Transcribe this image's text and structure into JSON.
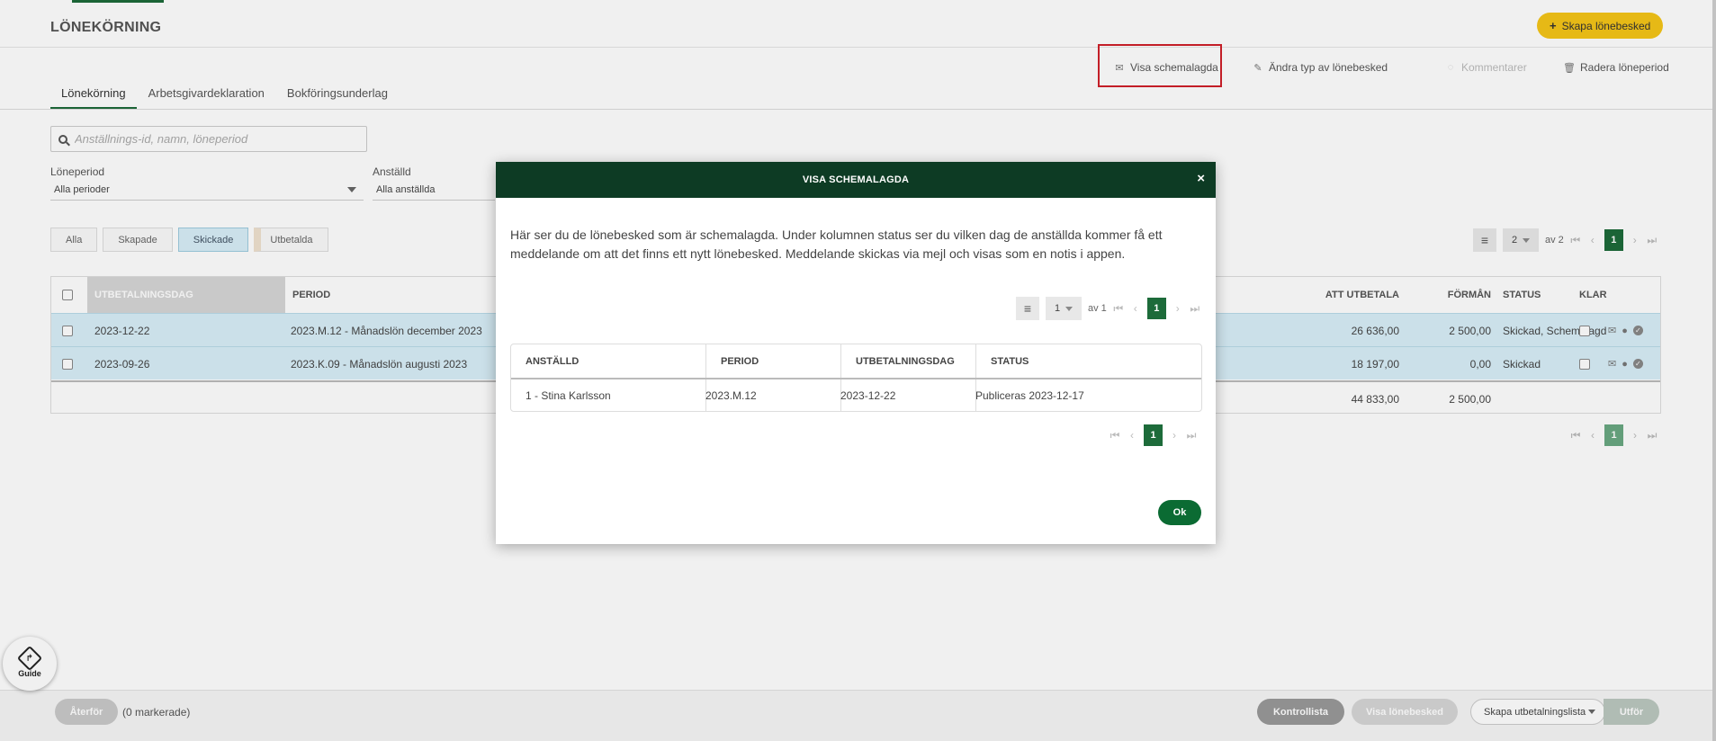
{
  "page": {
    "title": "LÖNEKÖRNING",
    "create_button": "Skapa lönebesked",
    "actions": [
      {
        "label": "Visa schemalagda",
        "icon": "envelope-icon"
      },
      {
        "label": "Ändra typ av lönebesked",
        "icon": "edit-icon"
      },
      {
        "label": "Kommentarer",
        "icon": "comment-icon"
      },
      {
        "label": "Radera löneperiod",
        "icon": "trash-icon"
      }
    ],
    "tabs": [
      "Lönekörning",
      "Arbetsgivardeklaration",
      "Bokföringsunderlag"
    ],
    "search_placeholder": "Anställnings-id, namn, löneperiod",
    "filter_period_label": "Löneperiod",
    "filter_period_value": "Alla perioder",
    "filter_employee_label": "Anställd",
    "filter_employee_value": "Alla anställda",
    "status_filters": [
      "Alla",
      "Skapade",
      "Skickade",
      "Utbetalda"
    ],
    "pager": {
      "select": "2",
      "of": "av 2",
      "current": "1"
    },
    "table": {
      "headers": [
        "UTBETALNINGSDAG",
        "PERIOD",
        "ATT UTBETALA",
        "FÖRMÅN",
        "STATUS",
        "KLAR"
      ],
      "rows": [
        {
          "date": "2023-12-22",
          "period": "2023.M.12 - Månadslön december 2023",
          "amount": "26 636,00",
          "benefit": "2 500,00",
          "status": "Skickad, Schemalagd"
        },
        {
          "date": "2023-09-26",
          "period": "2023.K.09 - Månadslön augusti 2023",
          "amount": "18 197,00",
          "benefit": "0,00",
          "status": "Skickad"
        }
      ],
      "sum_amount": "44 833,00",
      "sum_benefit": "2 500,00"
    },
    "bottom_pager_current": "1",
    "guide_label": "Guide",
    "footer": {
      "undo": "Återför",
      "selected": "(0 markerade)",
      "checklist": "Kontrollista",
      "show_payslip": "Visa lönebesked",
      "payment_select": "Skapa utbetalningslista",
      "execute": "Utför"
    }
  },
  "modal": {
    "title": "VISA SCHEMALAGDA",
    "text": "Här ser du de lönebesked som är schemalagda. Under kolumnen status ser du vilken dag de anställda kommer få ett meddelande om att det finns ett nytt lönebesked. Meddelande skickas via mejl och visas som en notis i appen.",
    "pager": {
      "select": "1",
      "of": "av 1",
      "current": "1"
    },
    "headers": [
      "ANSTÄLLD",
      "PERIOD",
      "UTBETALNINGSDAG",
      "STATUS"
    ],
    "rows": [
      {
        "employee": "1 - Stina Karlsson",
        "period": "2023.M.12",
        "date": "2023-12-22",
        "status": "Publiceras 2023-12-17"
      }
    ],
    "bottom_pager_current": "1",
    "ok": "Ok"
  },
  "colors": {
    "primary": "#0d3b24",
    "accent": "#1d6b3a",
    "yellow": "#f5c518",
    "highlight_border": "#d0202a",
    "row_selected": "#d8eef8"
  }
}
